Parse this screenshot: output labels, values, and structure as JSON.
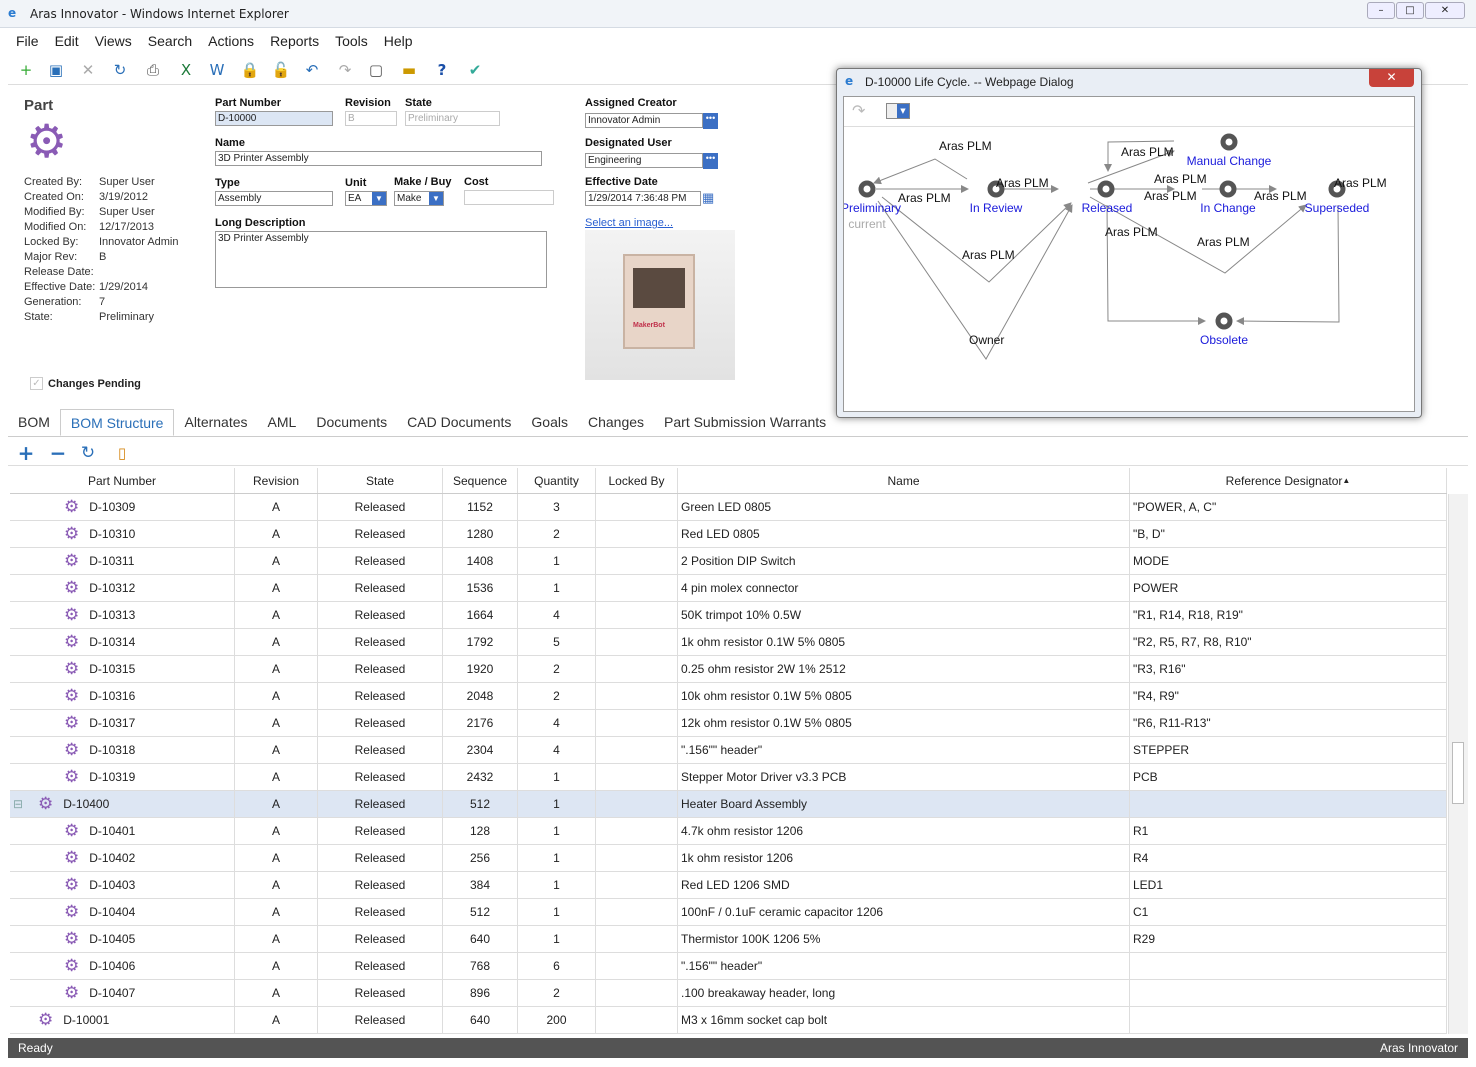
{
  "window": {
    "title": "Aras Innovator - Windows Internet Explorer"
  },
  "menu": [
    "File",
    "Edit",
    "Views",
    "Search",
    "Actions",
    "Reports",
    "Tools",
    "Help"
  ],
  "form": {
    "item_type": "Part",
    "meta": [
      [
        "Created By:",
        "Super User"
      ],
      [
        "Created On:",
        "3/19/2012"
      ],
      [
        "Modified By:",
        "Super User"
      ],
      [
        "Modified On:",
        "12/17/2013"
      ],
      [
        "Locked By:",
        "Innovator Admin"
      ],
      [
        "Major Rev:",
        "B"
      ],
      [
        "Release Date:",
        ""
      ],
      [
        "Effective Date:",
        "1/29/2014"
      ],
      [
        "Generation:",
        "7"
      ],
      [
        "State:",
        "Preliminary"
      ]
    ],
    "part_number_label": "Part Number",
    "part_number": "D-10000",
    "revision_label": "Revision",
    "revision": "B",
    "state_label": "State",
    "state": "Preliminary",
    "name_label": "Name",
    "name": "3D Printer Assembly",
    "type_label": "Type",
    "type": "Assembly",
    "unit_label": "Unit",
    "unit": "EA",
    "make_buy_label": "Make / Buy",
    "make_buy": "Make",
    "cost_label": "Cost",
    "cost": "",
    "long_desc_label": "Long Description",
    "long_desc": "3D Printer Assembly",
    "assigned_creator_label": "Assigned Creator",
    "assigned_creator": "Innovator Admin",
    "designated_user_label": "Designated User",
    "designated_user": "Engineering",
    "effective_date_label": "Effective Date",
    "effective_date": "1/29/2014 7:36:48 PM",
    "select_image": "Select an image...",
    "changes_pending": "Changes Pending"
  },
  "tabs": [
    "BOM",
    "BOM Structure",
    "Alternates",
    "AML",
    "Documents",
    "CAD Documents",
    "Goals",
    "Changes",
    "Part Submission Warrants"
  ],
  "active_tab": "BOM Structure",
  "grid": {
    "columns": [
      "Part Number",
      "Revision",
      "State",
      "Sequence",
      "Quantity",
      "Locked By",
      "Name",
      "Reference Designator"
    ],
    "sort_column": "Reference Designator",
    "sort_dir": "asc",
    "rows": [
      {
        "level": 2,
        "pn": "D-10309",
        "rev": "A",
        "state": "Released",
        "seq": "1152",
        "qty": "3",
        "locked": "",
        "name": "Green LED 0805",
        "ref": "\"POWER, A, C\""
      },
      {
        "level": 2,
        "pn": "D-10310",
        "rev": "A",
        "state": "Released",
        "seq": "1280",
        "qty": "2",
        "locked": "",
        "name": "Red LED 0805",
        "ref": "\"B, D\""
      },
      {
        "level": 2,
        "pn": "D-10311",
        "rev": "A",
        "state": "Released",
        "seq": "1408",
        "qty": "1",
        "locked": "",
        "name": "2 Position DIP Switch",
        "ref": "MODE"
      },
      {
        "level": 2,
        "pn": "D-10312",
        "rev": "A",
        "state": "Released",
        "seq": "1536",
        "qty": "1",
        "locked": "",
        "name": "4 pin molex connector",
        "ref": "POWER"
      },
      {
        "level": 2,
        "pn": "D-10313",
        "rev": "A",
        "state": "Released",
        "seq": "1664",
        "qty": "4",
        "locked": "",
        "name": "50K trimpot 10% 0.5W",
        "ref": "\"R1, R14, R18, R19\""
      },
      {
        "level": 2,
        "pn": "D-10314",
        "rev": "A",
        "state": "Released",
        "seq": "1792",
        "qty": "5",
        "locked": "",
        "name": "1k ohm resistor 0.1W 5% 0805",
        "ref": "\"R2, R5, R7, R8, R10\""
      },
      {
        "level": 2,
        "pn": "D-10315",
        "rev": "A",
        "state": "Released",
        "seq": "1920",
        "qty": "2",
        "locked": "",
        "name": "0.25 ohm resistor 2W 1% 2512",
        "ref": "\"R3, R16\""
      },
      {
        "level": 2,
        "pn": "D-10316",
        "rev": "A",
        "state": "Released",
        "seq": "2048",
        "qty": "2",
        "locked": "",
        "name": "10k ohm resistor 0.1W 5% 0805",
        "ref": "\"R4, R9\""
      },
      {
        "level": 2,
        "pn": "D-10317",
        "rev": "A",
        "state": "Released",
        "seq": "2176",
        "qty": "4",
        "locked": "",
        "name": "12k ohm resistor 0.1W 5% 0805",
        "ref": "\"R6, R11-R13\""
      },
      {
        "level": 2,
        "pn": "D-10318",
        "rev": "A",
        "state": "Released",
        "seq": "2304",
        "qty": "4",
        "locked": "",
        "name": "\".156\"\" header\"",
        "ref": "STEPPER"
      },
      {
        "level": 2,
        "pn": "D-10319",
        "rev": "A",
        "state": "Released",
        "seq": "2432",
        "qty": "1",
        "locked": "",
        "name": "Stepper Motor Driver v3.3 PCB",
        "ref": "PCB"
      },
      {
        "level": 1,
        "pn": "D-10400",
        "rev": "A",
        "state": "Released",
        "seq": "512",
        "qty": "1",
        "locked": "",
        "name": "Heater Board Assembly",
        "ref": "",
        "expanded": true,
        "selected": true
      },
      {
        "level": 2,
        "pn": "D-10401",
        "rev": "A",
        "state": "Released",
        "seq": "128",
        "qty": "1",
        "locked": "",
        "name": "4.7k ohm resistor 1206",
        "ref": "R1"
      },
      {
        "level": 2,
        "pn": "D-10402",
        "rev": "A",
        "state": "Released",
        "seq": "256",
        "qty": "1",
        "locked": "",
        "name": "1k ohm resistor 1206",
        "ref": "R4"
      },
      {
        "level": 2,
        "pn": "D-10403",
        "rev": "A",
        "state": "Released",
        "seq": "384",
        "qty": "1",
        "locked": "",
        "name": "Red LED 1206 SMD",
        "ref": "LED1"
      },
      {
        "level": 2,
        "pn": "D-10404",
        "rev": "A",
        "state": "Released",
        "seq": "512",
        "qty": "1",
        "locked": "",
        "name": "100nF / 0.1uF ceramic capacitor 1206",
        "ref": "C1"
      },
      {
        "level": 2,
        "pn": "D-10405",
        "rev": "A",
        "state": "Released",
        "seq": "640",
        "qty": "1",
        "locked": "",
        "name": "Thermistor 100K 1206 5%",
        "ref": "R29"
      },
      {
        "level": 2,
        "pn": "D-10406",
        "rev": "A",
        "state": "Released",
        "seq": "768",
        "qty": "6",
        "locked": "",
        "name": "\".156\"\" header\"",
        "ref": ""
      },
      {
        "level": 2,
        "pn": "D-10407",
        "rev": "A",
        "state": "Released",
        "seq": "896",
        "qty": "2",
        "locked": "",
        "name": ".100 breakaway header, long",
        "ref": ""
      },
      {
        "level": 1,
        "pn": "D-10001",
        "rev": "A",
        "state": "Released",
        "seq": "640",
        "qty": "200",
        "locked": "",
        "name": "M3 x 16mm socket cap bolt",
        "ref": ""
      }
    ]
  },
  "status": {
    "left": "Ready",
    "right": "Aras Innovator"
  },
  "dialog": {
    "title": "D-10000 Life Cycle. -- Webpage Dialog",
    "states": {
      "preliminary": "Preliminary",
      "current": "current",
      "in_review": "In Review",
      "released": "Released",
      "manual_change": "Manual Change",
      "in_change": "In Change",
      "superseded": "Superseded",
      "obsolete": "Obsolete"
    },
    "transition_role": "Aras PLM",
    "owner_role": "Owner"
  },
  "colors": {
    "accent": "#2a6fb8",
    "part_icon": "#8a5bb5",
    "state_link": "#1a1adb",
    "status_bar": "#545454",
    "selected_row": "#dde6f3"
  }
}
